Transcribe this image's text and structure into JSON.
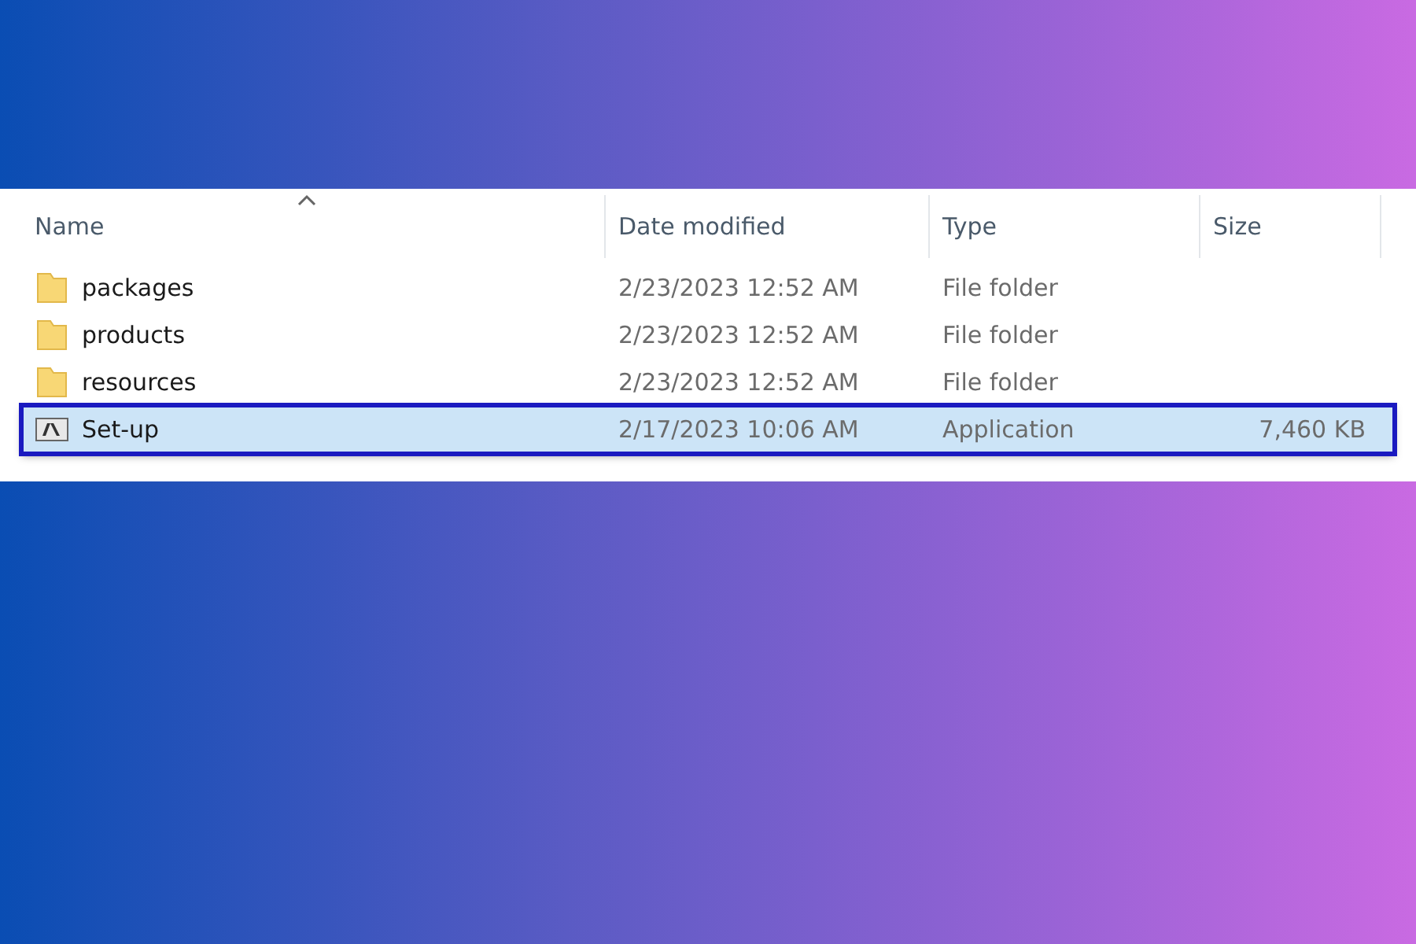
{
  "columns": [
    {
      "label": "Name",
      "sorted": true
    },
    {
      "label": "Date modified",
      "sorted": false
    },
    {
      "label": "Type",
      "sorted": false
    },
    {
      "label": "Size",
      "sorted": false
    }
  ],
  "rows": [
    {
      "kind": "folder",
      "name": "packages",
      "date": "2/23/2023 12:52 AM",
      "type": "File folder",
      "selected": false
    },
    {
      "kind": "folder",
      "name": "products",
      "date": "2/23/2023 12:52 AM",
      "type": "File folder",
      "selected": false
    },
    {
      "kind": "folder",
      "name": "resources",
      "date": "2/23/2023 12:52 AM",
      "type": "File folder",
      "selected": false
    },
    {
      "kind": "application",
      "name": "Set-up",
      "date": "2/17/2023 10:06 AM",
      "type": "Application",
      "size": "7,460 KB",
      "selected": true
    }
  ]
}
